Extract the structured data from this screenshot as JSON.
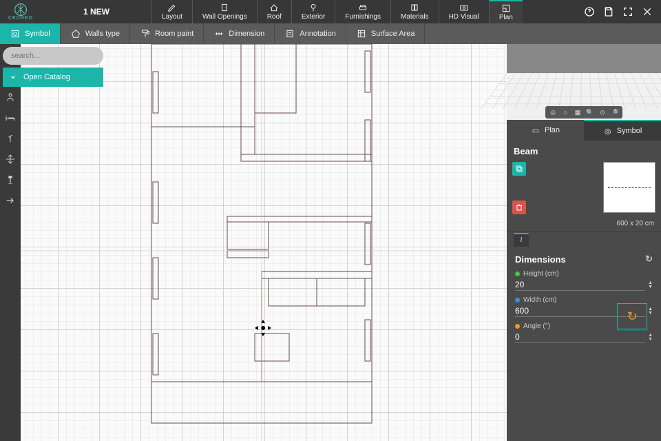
{
  "brand": "CEDREO",
  "project_title": "1 NEW",
  "top_tabs": {
    "layout": "Layout",
    "wall_openings": "Wall Openings",
    "roof": "Roof",
    "exterior": "Exterior",
    "furnishings": "Furnishings",
    "materials": "Materials",
    "hd_visual": "HD Visual",
    "plan": "Plan"
  },
  "sub_tabs": {
    "symbol": "Symbol",
    "walls_type": "Walls type",
    "room_paint": "Room paint",
    "dimension": "Dimension",
    "annotation": "Annotation",
    "surface_area": "Surface Area"
  },
  "search": {
    "placeholder": "search..."
  },
  "catalog_button": "Open Catalog",
  "right_panel": {
    "tab_plan": "Plan",
    "tab_symbol": "Symbol",
    "object_name": "Beam",
    "thumb_caption": "600 x 20 cm",
    "section_title": "Dimensions",
    "height_label": "Height (cm)",
    "height_value": "20",
    "width_label": "Width (cm)",
    "width_value": "600",
    "angle_label": "Angle (°)",
    "angle_value": "0"
  }
}
